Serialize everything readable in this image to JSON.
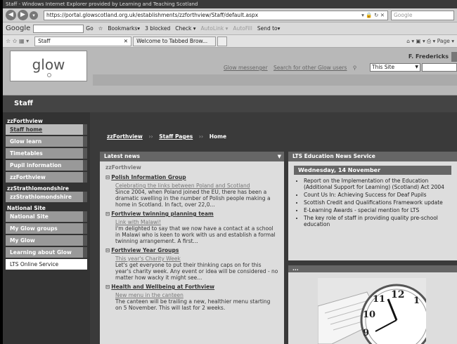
{
  "browser": {
    "title": "Staff - Windows Internet Explorer provided by Learning and Teaching Scotland",
    "url": "https://portal.glowscotland.org.uk/establishments/zzforthview/Staff/default.aspx",
    "search_placeholder": "Google",
    "google_label": "Google",
    "toolbar": {
      "go": "Go",
      "bookmarks": "Bookmarks▾",
      "blocked": "3 blocked",
      "check": "Check ▾",
      "autolink": "AutoLink ▾",
      "autofill": "AutoFill",
      "sendto": "Send to▾"
    },
    "tabs": [
      {
        "label": "Staff"
      },
      {
        "label": "Welcome to Tabbed Brow..."
      }
    ],
    "cmd_page": "Page ▾"
  },
  "glow": {
    "logo": "glow",
    "user": "F. Fredericks",
    "links": [
      "Glow messenger",
      "Search for other Glow users"
    ],
    "site_select": "This Site"
  },
  "page_title": "Staff",
  "sidebar": {
    "groups": [
      {
        "header": "zzForthview",
        "items": [
          {
            "label": "Staff home",
            "style": "light"
          },
          {
            "label": "Glow learn"
          },
          {
            "label": "Timetables"
          },
          {
            "label": "Pupil information"
          },
          {
            "label": "zzForthview"
          }
        ]
      },
      {
        "header": "zzStrathlomondshire",
        "items": [
          {
            "label": "zzStrathlomondshire"
          }
        ]
      },
      {
        "header": "National Site",
        "items": [
          {
            "label": "National Site"
          },
          {
            "label": "My Glow groups"
          },
          {
            "label": "My Glow"
          },
          {
            "label": "Learning about Glow"
          },
          {
            "label": "LTS Online Service",
            "style": "white"
          }
        ]
      }
    ]
  },
  "breadcrumb": [
    "zzForthview",
    "Staff Pages",
    "Home"
  ],
  "latest_news": {
    "title": "Latest news",
    "site": "zzForthview",
    "groups": [
      {
        "title": "Polish Information Group",
        "link": "Celebrating the links between Poland and Scotland",
        "text": "Since 2004, when Poland joined the EU, there has been a dramatic swelling in the number of Polish people making a home in Scotland. In fact, over 22,0..."
      },
      {
        "title": "Forthview twinning planning team",
        "link": "Link with Malawi!",
        "text": "I'm delighted to say that we now have a contact at a school in Malawi who is keen to work with us and establish a formal twinning arrangement. A first..."
      },
      {
        "title": "Forthview Year Groups",
        "link": "This year's Charity Week",
        "text": "Let's get everyone to put their thinking caps on for this year's charity week. Any event or idea will be considered - no matter how wacky it might see..."
      },
      {
        "title": "Health and Wellbeing at Forthview",
        "link": "New menu in the canteen",
        "text": "The canteen will be trailing a new, healthier menu starting on 5 November. This will last for 2 weeks."
      }
    ]
  },
  "lts": {
    "title": "LTS Education News Service",
    "date": "Wednesday, 14 November",
    "items": [
      "Report on the Implementation of the Education (Additional Support for Learning) (Scotland) Act 2004",
      "Count Us In: Achieving Success for Deaf Pupils",
      "Scottish Credit and Qualifications Framework update",
      "E-Learning Awards - special mention for LTS",
      "The key role of staff in providing quality pre-school education"
    ]
  },
  "image_panel": {
    "title": "..."
  }
}
